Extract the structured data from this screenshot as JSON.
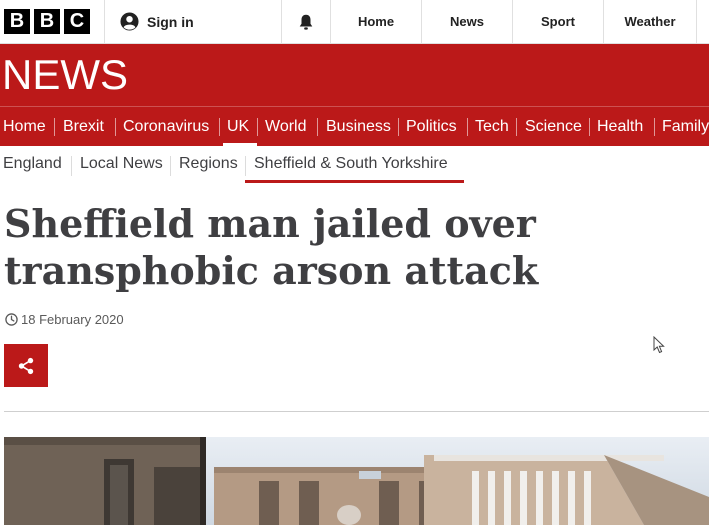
{
  "brand": {
    "bbc_letters": [
      "B",
      "B",
      "C"
    ],
    "news_word": "NEWS",
    "brand_color": "#bb1919"
  },
  "topbar": {
    "signin_label": "Sign in",
    "nav": [
      "Home",
      "News",
      "Sport",
      "Weather"
    ]
  },
  "section_nav": {
    "items": [
      "Home",
      "Brexit",
      "Coronavirus",
      "UK",
      "World",
      "Business",
      "Politics",
      "Tech",
      "Science",
      "Health",
      "Family"
    ],
    "active": "UK"
  },
  "subnav": {
    "items": [
      "England",
      "Local News",
      "Regions",
      "Sheffield & South Yorkshire"
    ],
    "active": "Sheffield & South Yorkshire"
  },
  "article": {
    "headline": "Sheffield man jailed over transphobic arson attack",
    "date": "18 February 2020"
  },
  "icons": {
    "signin": "user-icon",
    "notifications": "bell-icon",
    "date": "clock-icon",
    "share": "share-icon"
  }
}
